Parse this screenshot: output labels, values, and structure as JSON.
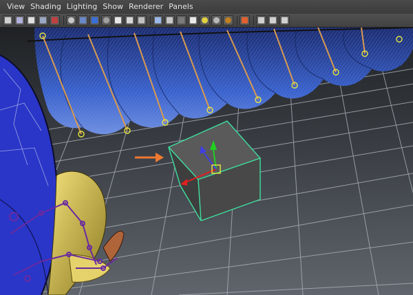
{
  "menu": {
    "items": [
      "View",
      "Shading",
      "Lighting",
      "Show",
      "Renderer",
      "Panels"
    ]
  },
  "toolbar": {
    "groups": [
      [
        "camera-attributes-icon",
        "bookmark-icon",
        "image-plane-icon",
        "grid-icon",
        "xray-icon"
      ],
      [
        "wireframe-icon",
        "smooth-shade-icon",
        "default-material-icon",
        "bounding-box-icon",
        "textured-icon",
        "use-all-lights-icon"
      ],
      [
        "shadows-icon",
        "isolate-select-icon",
        "xray-joints-icon",
        "resolution-gate-icon",
        "gate-mask-icon",
        "safe-action-icon"
      ],
      [
        "isolate-object-icon",
        "xray-active-icon",
        "texture-icon"
      ]
    ]
  },
  "colors": {
    "menubar": "#3c3c3c",
    "viewport_bg_top": "#242629",
    "viewport_bg_bottom": "#5a5f66",
    "grid": "#a9adb3",
    "selection": "#3ee0a0",
    "feathers": "#2c4fb8",
    "joint": "#c8c832",
    "arrow": "#f07830",
    "manipulator_x": "#e02020",
    "manipulator_y": "#20d020",
    "manipulator_z": "#4040e0"
  }
}
